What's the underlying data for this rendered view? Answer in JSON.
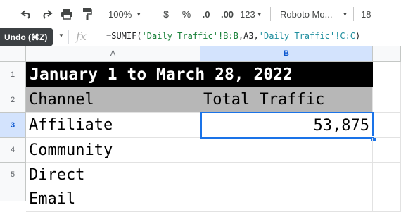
{
  "toolbar": {
    "zoom": "100%",
    "currency": "$",
    "percent": "%",
    "decrease_decimals": ".0",
    "increase_decimals": ".00",
    "number_format": "123",
    "font": "Roboto Mo...",
    "font_size": "18"
  },
  "tooltip": "Undo (⌘Z)",
  "formula_bar": {
    "fx": "fx",
    "formula_prefix": "=SUMIF(",
    "formula_ref1": "'Daily Traffic'!B:B",
    "formula_mid": ",A3,",
    "formula_ref2": "'Daily Traffic'!C:C",
    "formula_suffix": ")"
  },
  "columns": [
    "A",
    "B"
  ],
  "rows": [
    "1",
    "2",
    "3",
    "4",
    "5"
  ],
  "sheet": {
    "title": "January 1 to March 28, 2022",
    "headers": [
      "Channel",
      "Total Traffic"
    ],
    "data": [
      {
        "channel": "Affiliate",
        "total": "53,875"
      },
      {
        "channel": "Community",
        "total": ""
      },
      {
        "channel": "Direct",
        "total": ""
      },
      {
        "channel": "Email",
        "total": ""
      }
    ]
  },
  "colors": {
    "title_bg": "#000000",
    "header_bg": "#b7b7b7",
    "selection": "#1a73e8"
  }
}
